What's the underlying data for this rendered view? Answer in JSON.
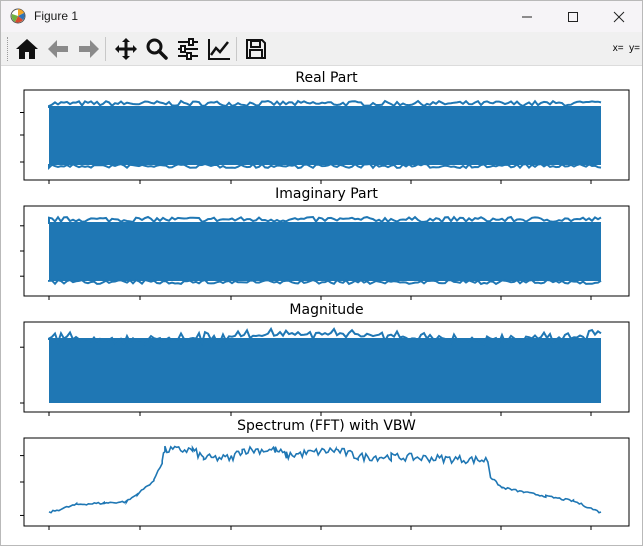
{
  "window": {
    "title": "Figure 1",
    "icon": "matplotlib-logo-icon",
    "controls": [
      "minimize-icon",
      "maximize-icon",
      "close-icon"
    ]
  },
  "toolbar": {
    "buttons": [
      {
        "name": "home-button",
        "icon": "home-icon"
      },
      {
        "name": "back-button",
        "icon": "arrow-left-icon"
      },
      {
        "name": "forward-button",
        "icon": "arrow-right-icon"
      },
      {
        "name": "pan-button",
        "icon": "move-arrows-icon"
      },
      {
        "name": "zoom-button",
        "icon": "magnifier-icon"
      },
      {
        "name": "configure-subplots-button",
        "icon": "sliders-icon"
      },
      {
        "name": "edit-axes-button",
        "icon": "line-chart-icon"
      },
      {
        "name": "save-button",
        "icon": "floppy-disk-icon"
      }
    ],
    "coordinates": "x=  y="
  },
  "colors": {
    "series": "#1f77b4",
    "axes": "#000000",
    "background": "#ffffff"
  },
  "chart_data": [
    {
      "type": "line",
      "title": "Real Part",
      "description": "dense oscillating signal band spanning the full width",
      "band": [
        {
          "x": 0,
          "low": -1,
          "high": 1
        },
        {
          "x": 1,
          "low": -1,
          "high": 1
        }
      ],
      "xlabel": "",
      "ylabel": "",
      "grid": false
    },
    {
      "type": "line",
      "title": "Imaginary Part",
      "band": [
        {
          "x": 0,
          "low": -1,
          "high": 1
        },
        {
          "x": 1,
          "low": -1,
          "high": 1
        }
      ],
      "xlabel": "",
      "ylabel": "",
      "grid": false
    },
    {
      "type": "line",
      "title": "Magnitude",
      "band": [
        {
          "x": 0,
          "low": 0,
          "high": 1
        },
        {
          "x": 1,
          "low": 0,
          "high": 1
        }
      ],
      "xlabel": "",
      "ylabel": "",
      "grid": false
    },
    {
      "type": "line",
      "title": "Spectrum (FFT) with VBW",
      "x": [
        0,
        0.05,
        0.1,
        0.14,
        0.16,
        0.19,
        0.205,
        0.21,
        0.26,
        0.28,
        0.33,
        0.35,
        0.41,
        0.43,
        0.52,
        0.56,
        0.62,
        0.795,
        0.8,
        0.82,
        0.86,
        0.9,
        0.95,
        1.0
      ],
      "y": [
        0.08,
        0.2,
        0.22,
        0.24,
        0.35,
        0.55,
        0.85,
        1.0,
        1.0,
        0.88,
        0.88,
        1.0,
        1.0,
        0.92,
        1.0,
        0.9,
        0.9,
        0.85,
        0.6,
        0.45,
        0.38,
        0.32,
        0.25,
        0.08
      ],
      "xlabel": "",
      "ylabel": "",
      "grid": false
    }
  ]
}
